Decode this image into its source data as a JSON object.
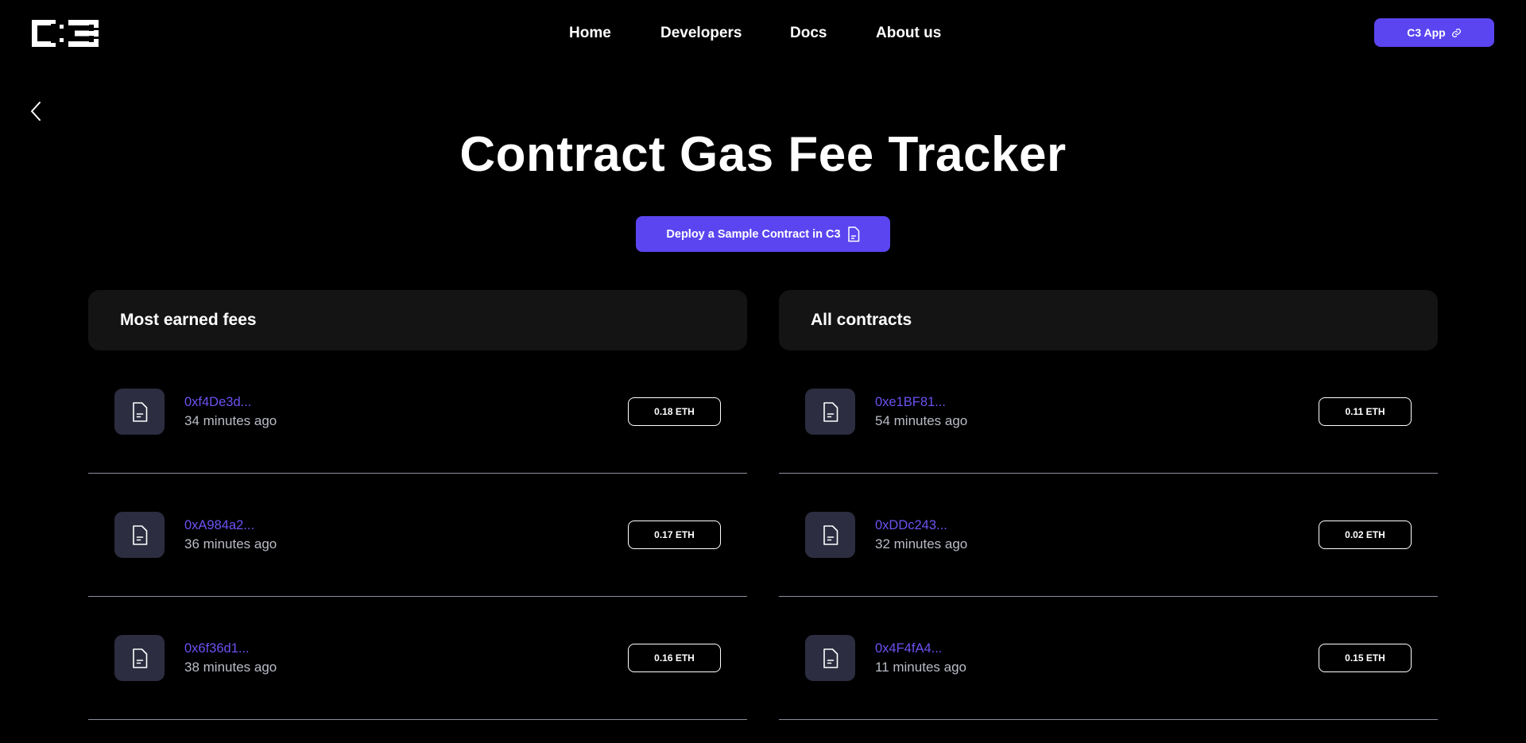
{
  "header": {
    "logo_text": "C3",
    "nav": [
      "Home",
      "Developers",
      "Docs",
      "About us"
    ],
    "app_button": "C3 App"
  },
  "hero": {
    "title": "Contract Gas Fee Tracker",
    "deploy_button": "Deploy a Sample Contract in C3"
  },
  "most_earned": {
    "title": "Most earned fees",
    "rows": [
      {
        "address": "0xf4De3d...",
        "time": "34 minutes ago",
        "fee": "0.18 ETH"
      },
      {
        "address": "0xA984a2...",
        "time": "36 minutes ago",
        "fee": "0.17 ETH"
      },
      {
        "address": "0x6f36d1...",
        "time": "38 minutes ago",
        "fee": "0.16 ETH"
      }
    ]
  },
  "all_contracts": {
    "title": "All contracts",
    "rows": [
      {
        "address": "0xe1BF81...",
        "time": "54 minutes ago",
        "fee": "0.11 ETH"
      },
      {
        "address": "0xDDc243...",
        "time": "32 minutes ago",
        "fee": "0.02 ETH"
      },
      {
        "address": "0x4F4fA4...",
        "time": "11 minutes ago",
        "fee": "0.15 ETH"
      }
    ]
  },
  "colors": {
    "accent": "#5b45f0",
    "address": "#6a53f2",
    "panel_bg": "#141414",
    "icon_bg": "#2c2d40"
  },
  "icons": {
    "back": "chevron-left-icon",
    "app_link": "link-icon",
    "contract": "document-icon"
  }
}
